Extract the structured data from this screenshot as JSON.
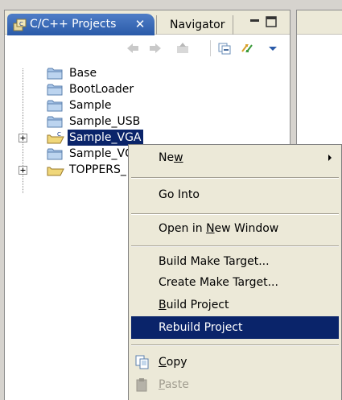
{
  "tabs": {
    "active_label": "C/C++ Projects",
    "close_glyph": "✕",
    "inactive_label": "Navigator"
  },
  "tree": {
    "items": [
      {
        "label": "Base",
        "icon": "folder-icon",
        "expandable": false,
        "selected": false
      },
      {
        "label": "BootLoader",
        "icon": "folder-icon",
        "expandable": false,
        "selected": false
      },
      {
        "label": "Sample",
        "icon": "folder-icon",
        "expandable": false,
        "selected": false
      },
      {
        "label": "Sample_USB",
        "icon": "folder-icon",
        "expandable": false,
        "selected": false
      },
      {
        "label": "Sample_VGA",
        "icon": "c-project-folder-icon",
        "expandable": true,
        "selected": true
      },
      {
        "label": "Sample_VC",
        "icon": "folder-icon",
        "expandable": false,
        "selected": false
      },
      {
        "label": "TOPPERS_",
        "icon": "open-folder-icon",
        "expandable": true,
        "selected": false
      }
    ]
  },
  "context_menu": {
    "new": {
      "pre": "Ne",
      "mnemonic": "w",
      "post": ""
    },
    "go_into": "Go Into",
    "open_new_window": {
      "pre": "Open in ",
      "mnemonic": "N",
      "post": "ew Window"
    },
    "build_make_target": "Build Make Target...",
    "create_make_target": "Create Make Target...",
    "build_project": {
      "pre": "",
      "mnemonic": "B",
      "post": "uild Project"
    },
    "rebuild_project": "Rebuild Project",
    "copy": {
      "pre": "",
      "mnemonic": "C",
      "post": "opy"
    },
    "paste": {
      "pre": "",
      "mnemonic": "P",
      "post": "aste"
    }
  },
  "colors": {
    "selection": "#0a246a",
    "menu_bg": "#ece9d8",
    "tab_active": "#2a5aa8"
  }
}
